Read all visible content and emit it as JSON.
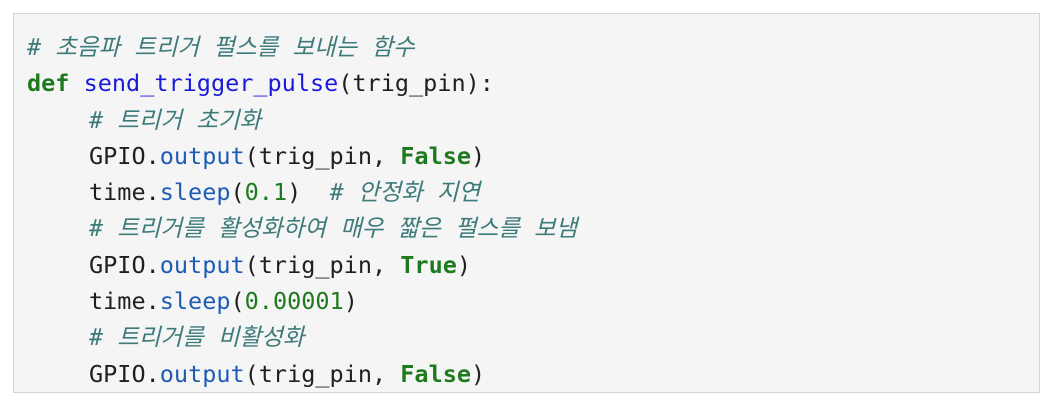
{
  "code": {
    "line1_comment": "# 초음파 트리거 펄스를 보내는 함수",
    "line2_kw_def": "def",
    "line2_fn_name": "send_trigger_pulse",
    "line2_params": "(trig_pin):",
    "line3_comment": "# 트리거 초기화",
    "line4_obj": "GPIO.",
    "line4_method": "output",
    "line4_args": "(trig_pin, ",
    "line4_kw": "False",
    "line4_close": ")",
    "line5_obj": "time.",
    "line5_method": "sleep",
    "line5_open": "(",
    "line5_num": "0.1",
    "line5_close": ")  ",
    "line5_comment": "# 안정화 지연",
    "line6_comment": "# 트리거를 활성화하여 매우 짧은 펄스를 보냄",
    "line7_obj": "GPIO.",
    "line7_method": "output",
    "line7_args": "(trig_pin, ",
    "line7_kw": "True",
    "line7_close": ")",
    "line8_obj": "time.",
    "line8_method": "sleep",
    "line8_open": "(",
    "line8_num": "0.00001",
    "line8_close": ")",
    "line9_comment": "# 트리거를 비활성화",
    "line10_obj": "GPIO.",
    "line10_method": "output",
    "line10_args": "(trig_pin, ",
    "line10_kw": "False",
    "line10_close": ")"
  },
  "colors": {
    "background": "#f5f5f5",
    "border": "#d4d4d4",
    "comment": "#3d7a7a",
    "keyword": "#1f7a1f",
    "function_name": "#1a1ad9",
    "method": "#1f5cb3",
    "number": "#1f7a1f",
    "text": "#1f1f1f"
  }
}
